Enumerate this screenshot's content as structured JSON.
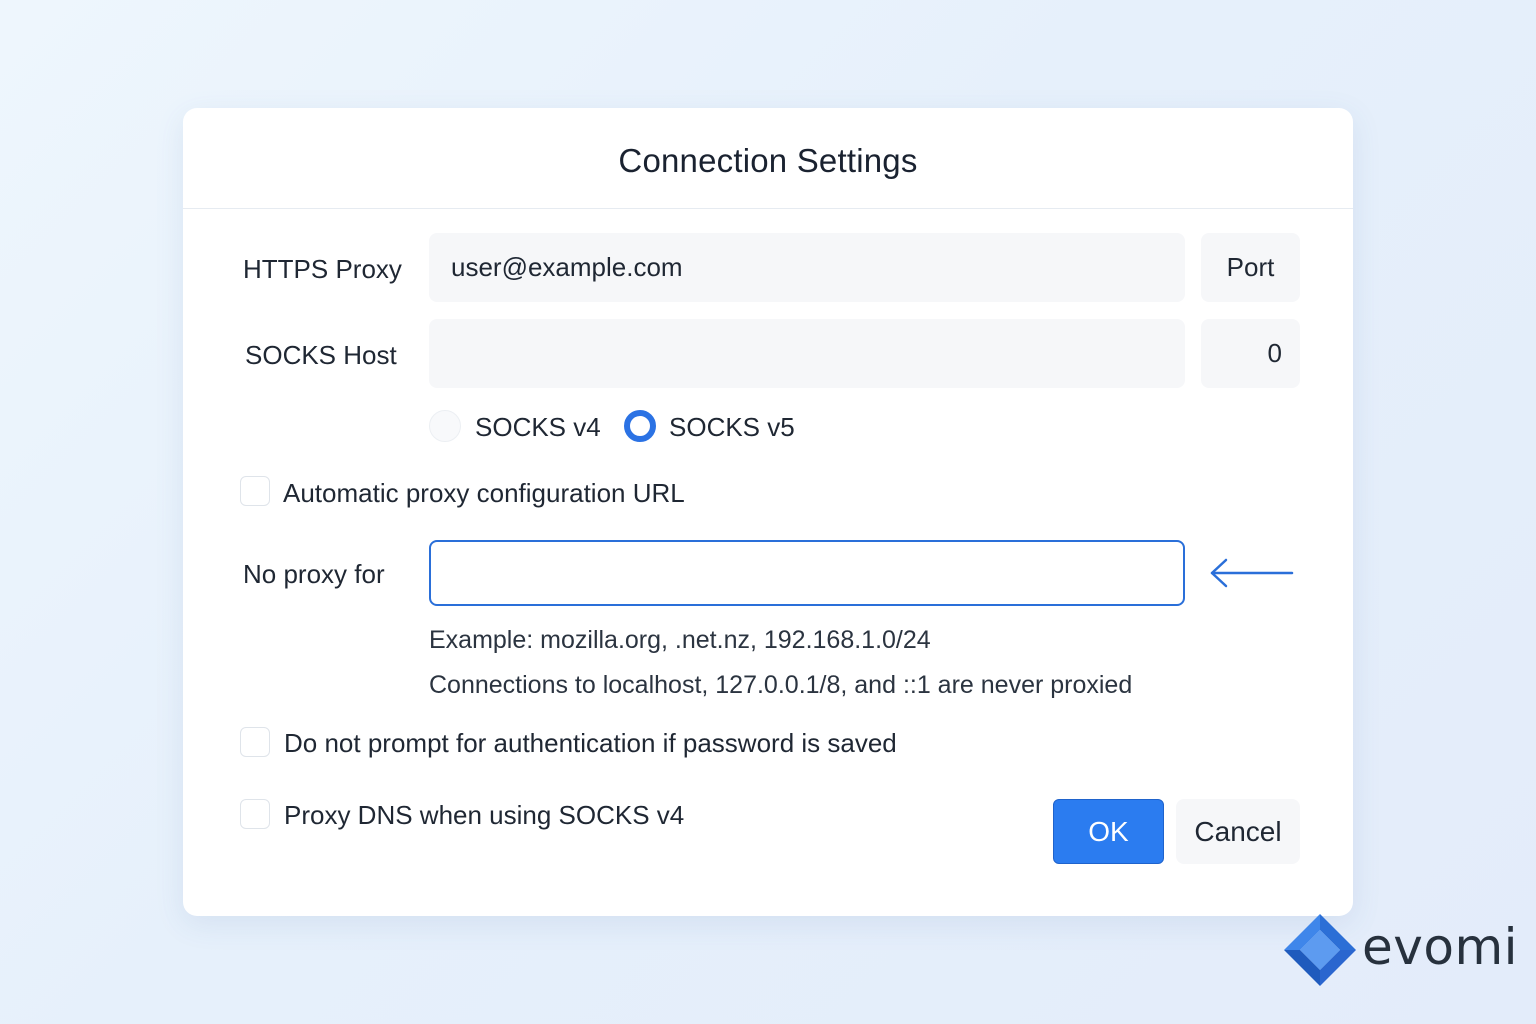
{
  "dialog": {
    "title": "Connection Settings"
  },
  "https_proxy": {
    "label": "HTTPS Proxy",
    "value": "user@example.com",
    "port_value": "Port"
  },
  "socks_host": {
    "label": "SOCKS Host",
    "value": "",
    "port_value": "0"
  },
  "socks_version": {
    "options": [
      {
        "label": "SOCKS v4",
        "checked": false
      },
      {
        "label": "SOCKS v5",
        "checked": true
      }
    ]
  },
  "auto_proxy": {
    "label": "Automatic proxy configuration URL",
    "checked": false
  },
  "no_proxy": {
    "label": "No proxy for",
    "value": "",
    "hint_example": "Example: mozilla.org, .net.nz, 192.168.1.0/24",
    "hint_localhost": "Connections to localhost, 127.0.0.1/8, and ::1 are never proxied"
  },
  "no_auth_prompt": {
    "label": "Do not prompt for authentication if password is saved",
    "checked": false
  },
  "proxy_dns": {
    "label": "Proxy DNS when using SOCKS v4",
    "checked": false
  },
  "buttons": {
    "ok": "OK",
    "cancel": "Cancel"
  },
  "brand": {
    "name": "evomi",
    "logo_icon": "evomi-logo-icon"
  },
  "colors": {
    "accent": "#2b7cf0",
    "focus_border": "#2a6fd9",
    "field_bg": "#f6f7f9"
  },
  "icons": {
    "arrow": "left-arrow-icon"
  }
}
